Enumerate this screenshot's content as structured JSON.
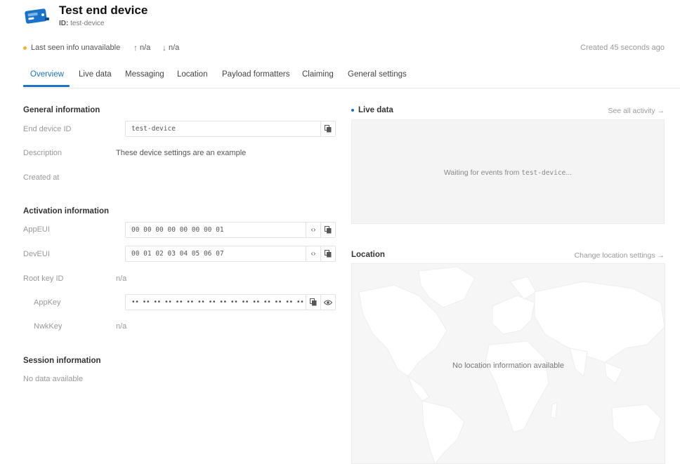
{
  "header": {
    "title": "Test end device",
    "id_label": "ID:",
    "id_value": "test-device",
    "status_text": "Last seen info unavailable",
    "uplink": "n/a",
    "downlink": "n/a",
    "created_text": "Created 45 seconds ago"
  },
  "tabs": [
    {
      "label": "Overview",
      "active": true
    },
    {
      "label": "Live data"
    },
    {
      "label": "Messaging"
    },
    {
      "label": "Location"
    },
    {
      "label": "Payload formatters"
    },
    {
      "label": "Claiming"
    },
    {
      "label": "General settings"
    }
  ],
  "general": {
    "title": "General information",
    "end_device_id_label": "End device ID",
    "end_device_id_value": "test-device",
    "description_label": "Description",
    "description_value": "These device settings are an example",
    "created_at_label": "Created at"
  },
  "activation": {
    "title": "Activation information",
    "appeui_label": "AppEUI",
    "appeui_value": "00 00 00 00 00 00 00 01",
    "deveui_label": "DevEUI",
    "deveui_value": "00 01 02 03 04 05 06 07",
    "root_key_id_label": "Root key ID",
    "root_key_id_value": "n/a",
    "appkey_label": "AppKey",
    "appkey_value": "•• •• •• •• •• •• •• •• •• •• •• •• •• •• •• ••",
    "nwkkey_label": "NwkKey",
    "nwkkey_value": "n/a"
  },
  "session": {
    "title": "Session information",
    "empty_text": "No data available"
  },
  "live_data": {
    "title": "Live data",
    "link": "See all activity →",
    "waiting_prefix": "Waiting for events from ",
    "waiting_device": "test-device",
    "waiting_suffix": "..."
  },
  "location": {
    "title": "Location",
    "link": "Change location settings →",
    "empty_text": "No location information available"
  },
  "colors": {
    "accent": "#1a73c9",
    "status_dot": "#f0b429"
  }
}
